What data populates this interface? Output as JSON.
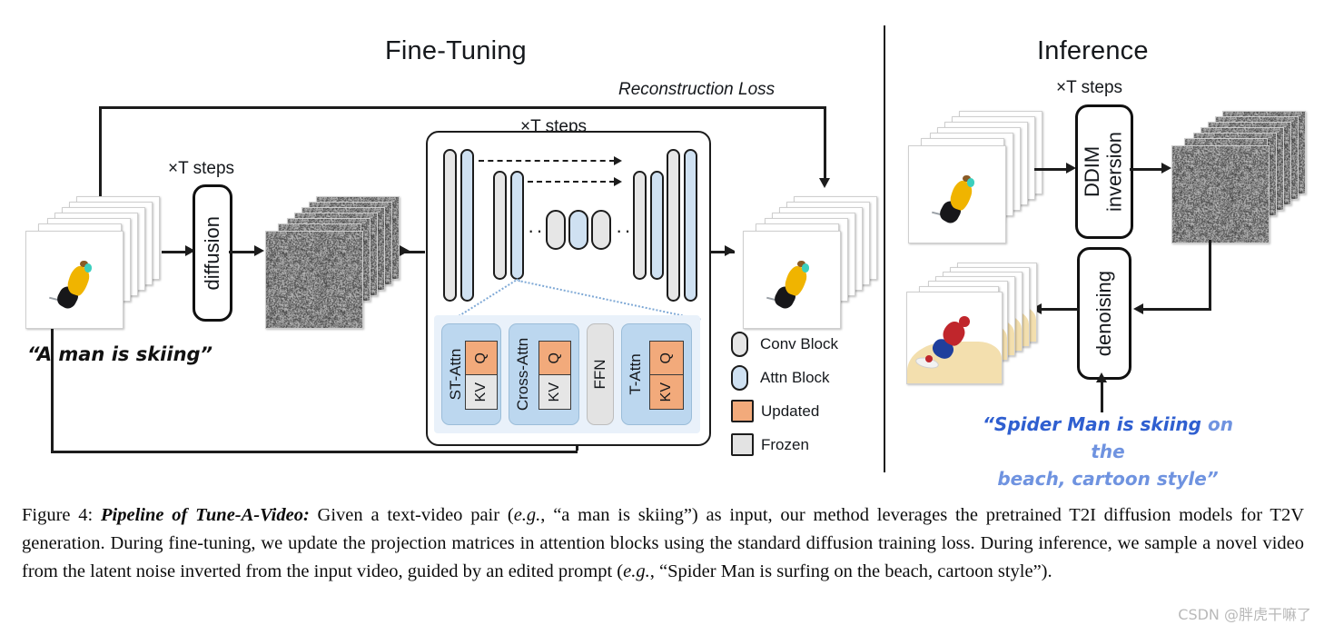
{
  "figure": {
    "panels": {
      "left_title": "Fine-Tuning",
      "right_title": "Inference"
    },
    "labels": {
      "reconstruction_loss": "Reconstruction Loss",
      "steps_diffusion": "×T steps",
      "steps_unet": "×T steps",
      "steps_inference": "×T steps",
      "ellipsis_left": "···",
      "ellipsis_right": "···"
    },
    "process_boxes": {
      "diffusion": "diffusion",
      "ddim_inversion_line1": "DDIM",
      "ddim_inversion_line2": "inversion",
      "denoising": "denoising"
    },
    "attention_blocks": [
      {
        "name": "ST-Attn",
        "q": "Q",
        "kv": "KV",
        "q_state": "updated",
        "kv_state": "frozen"
      },
      {
        "name": "Cross-Attn",
        "q": "Q",
        "kv": "KV",
        "q_state": "updated",
        "kv_state": "frozen"
      },
      {
        "name": "FFN",
        "q": null,
        "kv": null,
        "q_state": "frozen",
        "kv_state": "frozen"
      },
      {
        "name": "T-Attn",
        "q": "Q",
        "kv": "KV",
        "q_state": "updated",
        "kv_state": "updated"
      }
    ],
    "legend": [
      {
        "label": "Conv Block",
        "shape": "pill",
        "color": "#e6e6e6"
      },
      {
        "label": "Attn Block",
        "shape": "pill",
        "color": "#cfe1f2"
      },
      {
        "label": "Updated",
        "shape": "square",
        "color": "#f2aa7b"
      },
      {
        "label": "Frozen",
        "shape": "square",
        "color": "#e3e3e3"
      }
    ],
    "prompts": {
      "input": "“A man is skiing”",
      "edited_kept": "“Spider Man is skiing",
      "edited_new_line1": " on the",
      "edited_new_line2": "beach, cartoon style”"
    },
    "colors": {
      "conv_block": "#e6e6e6",
      "attn_block": "#cfe1f2",
      "updated": "#f2aa7b",
      "frozen": "#e3e3e3",
      "detail_panel": "#e9f1fa",
      "attn_panel": "#bcd7ef",
      "prompt_blue_dark": "#2f5fd0",
      "prompt_blue_light": "#6f93e0",
      "stroke": "#1c1c1c"
    }
  },
  "caption": {
    "prefix": "Figure 4:",
    "bold_title": "Pipeline of Tune-A-Video:",
    "body_1": " Given a text-video pair (",
    "eg_1": "e.g.",
    "body_2": ", “a man is skiing”) as input, our method leverages the pretrained T2I diffusion models for T2V generation. During fine-tuning, we update the projection matrices in attention blocks using the standard diffusion training loss. During inference, we sample a novel video from the latent noise inverted from the input video, guided by an edited prompt (",
    "eg_2": "e.g.",
    "body_3": ", “Spider Man is surfing on the beach, cartoon style”)."
  },
  "watermark": "CSDN @胖虎干嘛了"
}
